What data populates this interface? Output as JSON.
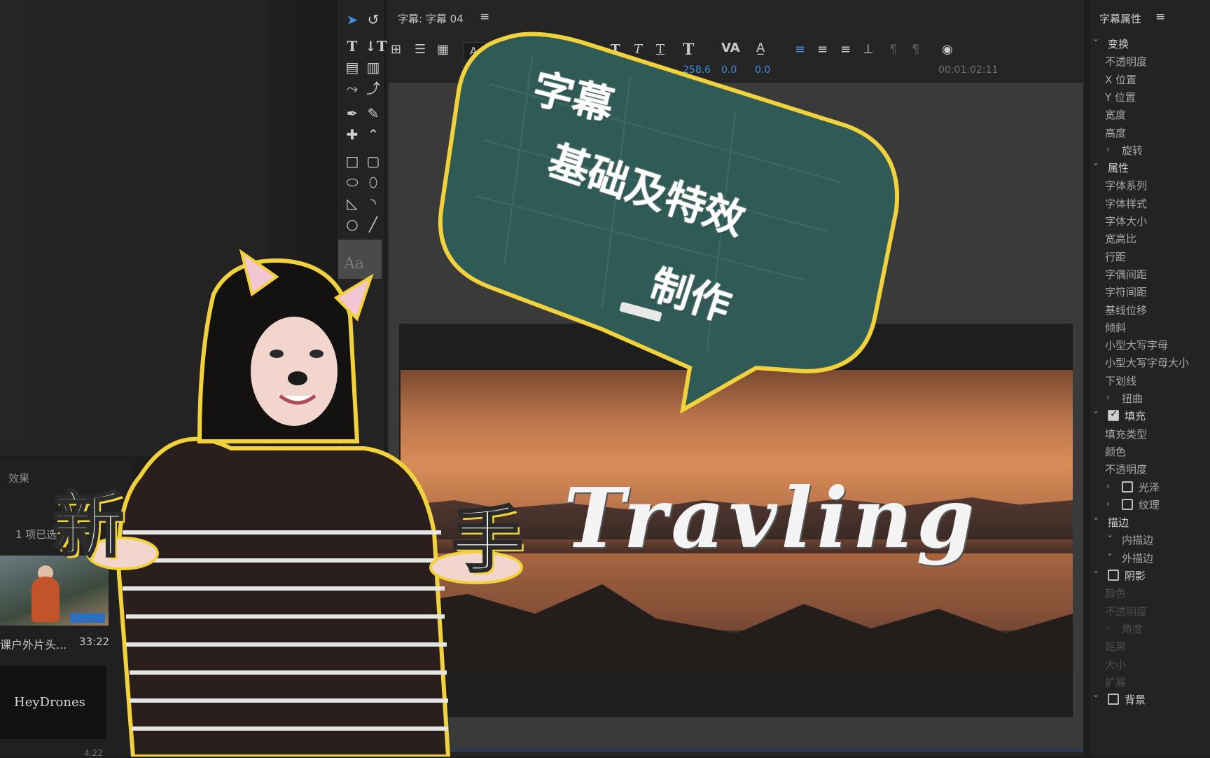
{
  "main_panel": {
    "title": "字幕: 字幕 04",
    "menu_icon": "menu-icon",
    "font_field": "Adob",
    "values": [
      "258.6",
      "0.0",
      "0.0"
    ],
    "timecode": "00:01:02:11"
  },
  "effects_panel": {
    "tab": "效果",
    "count": "1 项已选",
    "clip1_name": "课户外片头...",
    "clip1_duration": "33:22",
    "clip2_label": "HeyDrones",
    "clip2_duration": "4:22"
  },
  "props_panel": {
    "title": "字幕属性",
    "items": [
      {
        "label": "变换",
        "kind": "section",
        "expand": true
      },
      {
        "label": "不透明度",
        "kind": "item"
      },
      {
        "label": "X 位置",
        "kind": "item"
      },
      {
        "label": "Y 位置",
        "kind": "item"
      },
      {
        "label": "宽度",
        "kind": "item"
      },
      {
        "label": "高度",
        "kind": "item"
      },
      {
        "label": "旋转",
        "kind": "sub"
      },
      {
        "label": "属性",
        "kind": "section",
        "expand": true
      },
      {
        "label": "字体系列",
        "kind": "item"
      },
      {
        "label": "字体样式",
        "kind": "item"
      },
      {
        "label": "字体大小",
        "kind": "item"
      },
      {
        "label": "宽高比",
        "kind": "item"
      },
      {
        "label": "行距",
        "kind": "item"
      },
      {
        "label": "字偶间距",
        "kind": "item"
      },
      {
        "label": "字符间距",
        "kind": "item"
      },
      {
        "label": "基线位移",
        "kind": "item"
      },
      {
        "label": "倾斜",
        "kind": "item"
      },
      {
        "label": "小型大写字母",
        "kind": "item"
      },
      {
        "label": "小型大写字母大小",
        "kind": "item"
      },
      {
        "label": "下划线",
        "kind": "item"
      },
      {
        "label": "扭曲",
        "kind": "sub"
      },
      {
        "label": "填充",
        "kind": "section-check",
        "checked": true
      },
      {
        "label": "填充类型",
        "kind": "item"
      },
      {
        "label": "颜色",
        "kind": "item"
      },
      {
        "label": "不透明度",
        "kind": "item"
      },
      {
        "label": "光泽",
        "kind": "sub-check",
        "checked": false
      },
      {
        "label": "纹理",
        "kind": "sub-check",
        "checked": false
      },
      {
        "label": "描边",
        "kind": "section",
        "expand": true
      },
      {
        "label": "内描边",
        "kind": "sub-open"
      },
      {
        "label": "外描边",
        "kind": "sub-open"
      },
      {
        "label": "阴影",
        "kind": "section-check",
        "checked": false
      },
      {
        "label": "颜色",
        "kind": "dim"
      },
      {
        "label": "不透明度",
        "kind": "dim"
      },
      {
        "label": "角度",
        "kind": "dim-sub"
      },
      {
        "label": "距离",
        "kind": "dim"
      },
      {
        "label": "大小",
        "kind": "dim"
      },
      {
        "label": "扩展",
        "kind": "dim"
      },
      {
        "label": "背景",
        "kind": "section-check",
        "checked": false
      }
    ]
  },
  "overlay": {
    "bubble_line1": "字幕",
    "bubble_line2": "基础及特效",
    "bubble_line3": "制作",
    "big_left": "新",
    "big_right": "手",
    "video_title": "Travling"
  },
  "colors": {
    "accent_blue": "#3f8edb",
    "bubble_fill": "#2f5a55",
    "bubble_outline": "#f1d23c"
  }
}
